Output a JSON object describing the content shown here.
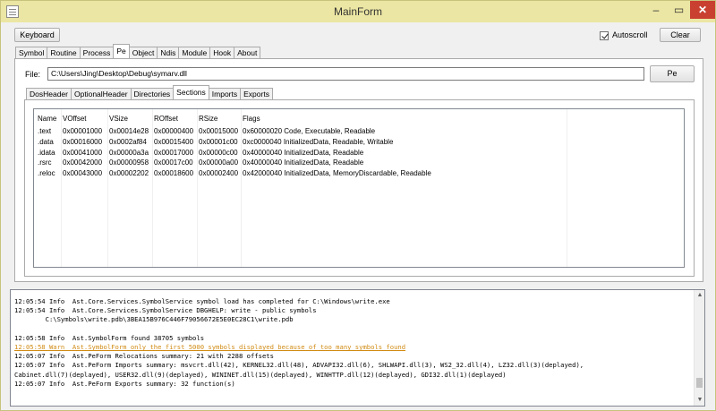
{
  "window": {
    "title": "MainForm",
    "controls": {
      "minimize": "–",
      "maximize": "▭",
      "close": "✕"
    }
  },
  "toolbar": {
    "keyboard_label": "Keyboard",
    "autoscroll_label": "Autoscroll",
    "autoscroll_checked": true,
    "clear_label": "Clear"
  },
  "main_tabs": [
    "Symbol",
    "Routine",
    "Process",
    "Pe",
    "Object",
    "Ndis",
    "Module",
    "Hook",
    "About"
  ],
  "main_tab_active": "Pe",
  "pe": {
    "file_label": "File:",
    "file_value": "C:\\Users\\Jing\\Desktop\\Debug\\symarv.dll",
    "pe_button_label": "Pe",
    "sub_tabs": [
      "DosHeader",
      "OptionalHeader",
      "Directories",
      "Sections",
      "Imports",
      "Exports"
    ],
    "sub_tab_active": "Sections",
    "sections": {
      "columns": [
        "Name",
        "VOffset",
        "VSize",
        "ROffset",
        "RSize",
        "Flags"
      ],
      "rows": [
        [
          ".text",
          "0x00001000",
          "0x00014e28",
          "0x00000400",
          "0x00015000",
          "0x60000020 Code, Executable, Readable"
        ],
        [
          ".data",
          "0x00016000",
          "0x0002af84",
          "0x00015400",
          "0x00001c00",
          "0xc0000040 InitializedData, Readable, Writable"
        ],
        [
          ".idata",
          "0x00041000",
          "0x00000a3a",
          "0x00017000",
          "0x00000c00",
          "0x40000040 InitializedData, Readable"
        ],
        [
          ".rsrc",
          "0x00042000",
          "0x00000958",
          "0x00017c00",
          "0x00000a00",
          "0x40000040 InitializedData, Readable"
        ],
        [
          ".reloc",
          "0x00043000",
          "0x00002202",
          "0x00018600",
          "0x00002400",
          "0x42000040 InitializedData, MemoryDiscardable, Readable"
        ]
      ]
    }
  },
  "log": {
    "lines": [
      {
        "text": "12:05:54 Info  Ast.Core.Services.SymbolService symbol load has completed for C:\\Windows\\write.exe",
        "level": "info"
      },
      {
        "text": "12:05:54 Info  Ast.Core.Services.SymbolService DBGHELP: write - public symbols",
        "level": "info"
      },
      {
        "text": "        C:\\Symbols\\write.pdb\\3BEA15B976C446F79056672E5E0EC28C1\\write.pdb",
        "level": "info"
      },
      {
        "text": "",
        "level": "info"
      },
      {
        "text": "12:05:58 Info  Ast.SymbolForm found 38705 symbols",
        "level": "info"
      },
      {
        "text": "12:05:58 Warn  Ast.SymbolForm only the first 5000 symbols displayed because of too many symbols found",
        "level": "warn"
      },
      {
        "text": "12:05:07 Info  Ast.PeForm Relocations summary: 21 with 2288 offsets",
        "level": "info"
      },
      {
        "text": "12:05:07 Info  Ast.PeForm Imports summary: msvcrt.dll(42), KERNEL32.dll(48), ADVAPI32.dll(6), SHLWAPI.dll(3), WS2_32.dll(4), LZ32.dll(3)(deplayed),",
        "level": "info"
      },
      {
        "text": "Cabinet.dll(7)(deplayed), USER32.dll(9)(deplayed), WININET.dll(15)(deplayed), WINHTTP.dll(12)(deplayed), GDI32.dll(1)(deplayed)",
        "level": "info"
      },
      {
        "text": "12:05:07 Info  Ast.PeForm Exports summary: 32 function(s)",
        "level": "info"
      }
    ]
  }
}
